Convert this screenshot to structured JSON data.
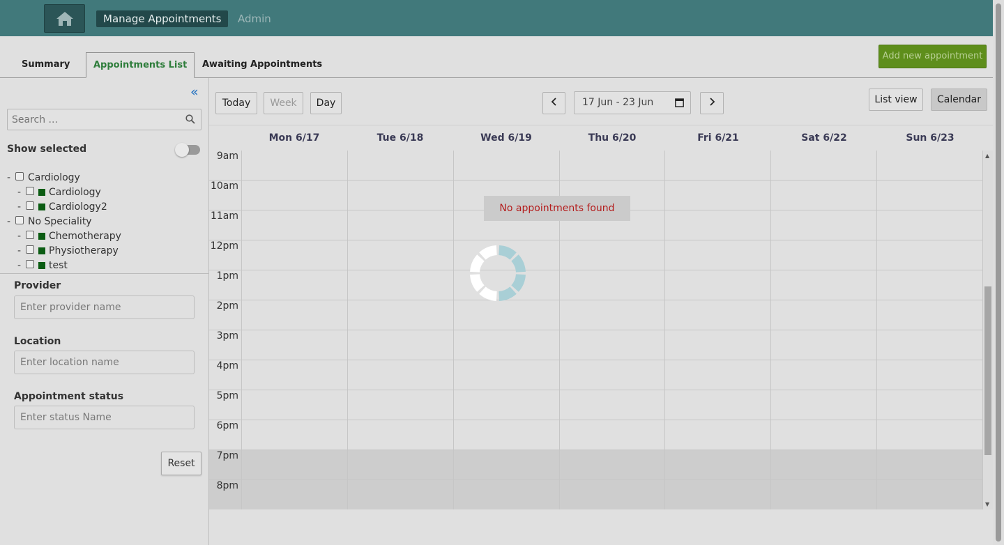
{
  "header": {
    "manage_label": "Manage Appointments",
    "admin_label": "Admin",
    "bg_color": "#41797b"
  },
  "tabs": [
    {
      "label": "Summary",
      "active": false
    },
    {
      "label": "Appointments List",
      "active": true
    },
    {
      "label": "Awaiting Appointments",
      "active": false
    }
  ],
  "add_button_label": "Add new appointment",
  "sidebar": {
    "search_placeholder": "Search ...",
    "show_selected_label": "Show selected",
    "show_selected_on": false,
    "specialities": [
      {
        "name": "Cardiology",
        "services": [
          "Cardiology",
          "Cardiology2"
        ]
      },
      {
        "name": "No Speciality",
        "services": [
          "Chemotherapy",
          "Physiotherapy",
          "test"
        ]
      }
    ],
    "provider_label": "Provider",
    "provider_placeholder": "Enter provider name",
    "location_label": "Location",
    "location_placeholder": "Enter location name",
    "status_label": "Appointment status",
    "status_placeholder": "Enter status Name",
    "reset_label": "Reset"
  },
  "toolbar": {
    "today_label": "Today",
    "week_label": "Week",
    "day_label": "Day",
    "date_range": "17 Jun - 23 Jun",
    "list_view_label": "List view",
    "calendar_label": "Calendar"
  },
  "calendar": {
    "days": [
      "Mon 6/17",
      "Tue 6/18",
      "Wed 6/19",
      "Thu 6/20",
      "Fri 6/21",
      "Sat 6/22",
      "Sun 6/23"
    ],
    "hours": [
      "9am",
      "10am",
      "11am",
      "12pm",
      "1pm",
      "2pm",
      "3pm",
      "4pm",
      "5pm",
      "6pm",
      "7pm",
      "8pm"
    ],
    "no_appointments": "No appointments found"
  }
}
